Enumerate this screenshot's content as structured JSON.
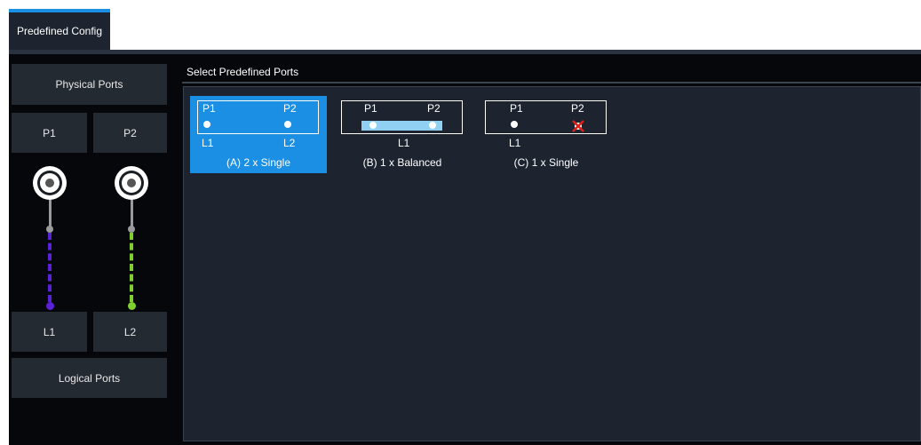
{
  "tab": {
    "label": "Predefined Config"
  },
  "left": {
    "physical_ports": "Physical Ports",
    "p1": "P1",
    "p2": "P2",
    "l1": "L1",
    "l2": "L2",
    "logical_ports": "Logical Ports"
  },
  "colors": {
    "accent": "#1b8fe3",
    "l1_line": "#5a21d6",
    "l2_line": "#7fcf2e"
  },
  "right": {
    "title": "Select Predefined Ports",
    "options": [
      {
        "p1": "P1",
        "p2": "P2",
        "l1": "L1",
        "l2": "L2",
        "caption": "(A) 2 x Single",
        "selected": true
      },
      {
        "p1": "P1",
        "p2": "P2",
        "l1": "L1",
        "caption": "(B) 1 x Balanced",
        "selected": false
      },
      {
        "p1": "P1",
        "p2": "P2",
        "l1": "L1",
        "caption": "(C) 1 x Single",
        "selected": false
      }
    ]
  }
}
